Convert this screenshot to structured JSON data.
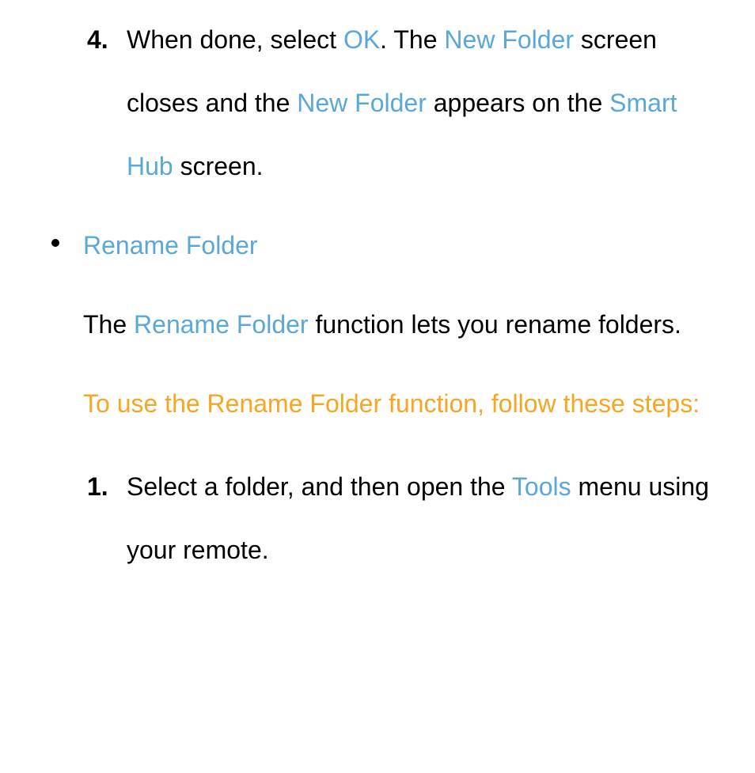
{
  "step4": {
    "marker": "4.",
    "t1": "When done, select ",
    "ok": "OK",
    "t2": ". The ",
    "nf1": "New Folder",
    "t3": " screen closes and the ",
    "nf2": "New Folder",
    "t4": " appears on the ",
    "sh": "Smart Hub",
    "t5": " screen."
  },
  "rename_header": "Rename Folder",
  "rename_desc": {
    "t1": "The ",
    "rf": "Rename Folder",
    "t2": " function lets you rename folders."
  },
  "instruction": "To use the Rename Folder function, follow these steps:",
  "step1": {
    "marker": "1.",
    "t1": "Select a folder, and then open the ",
    "tools": "Tools",
    "t2": " menu using your remote."
  }
}
